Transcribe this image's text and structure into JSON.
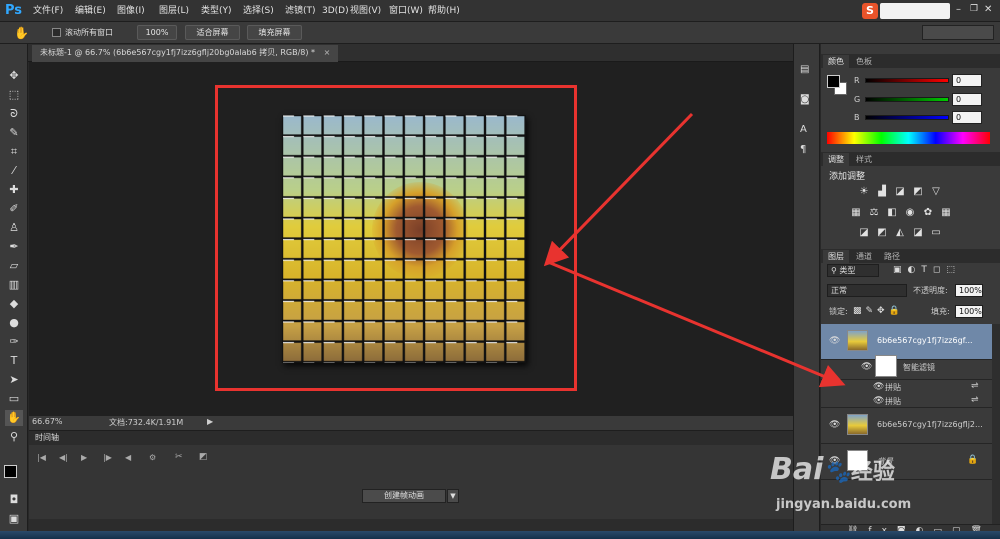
{
  "app": {
    "logo": "Ps"
  },
  "menu": [
    "文件(F)",
    "编辑(E)",
    "图像(I)",
    "图层(L)",
    "类型(Y)",
    "选择(S)",
    "滤镜(T)",
    "3D(D)",
    "视图(V)",
    "窗口(W)",
    "帮助(H)"
  ],
  "options": {
    "scroll_all_label": "滚动所有窗口",
    "zoom_100": "100%",
    "fit_screen": "适合屏幕",
    "fill_screen": "填充屏幕"
  },
  "document": {
    "tab_title": "未标题-1 @ 66.7% (6b6e567cgy1fj7izz6gflj20bg0alab6 拷贝, RGB/8) *"
  },
  "status": {
    "zoom": "66.67%",
    "doc_size": "文档:732.4K/1.91M"
  },
  "timeline": {
    "tab_label": "时间轴",
    "create_button": "创建帧动画"
  },
  "color_panel": {
    "tabs": [
      "颜色",
      "色板"
    ],
    "channels": [
      {
        "label": "R",
        "value": "0"
      },
      {
        "label": "G",
        "value": "0"
      },
      {
        "label": "B",
        "value": "0"
      }
    ]
  },
  "adjustments_panel": {
    "tabs": [
      "调整",
      "样式"
    ],
    "heading": "添加调整"
  },
  "layers_panel": {
    "tabs": [
      "图层",
      "通道",
      "路径"
    ],
    "filter_kind": "类型",
    "blend_mode": "正常",
    "opacity_label": "不透明度:",
    "opacity_value": "100%",
    "lock_label": "锁定:",
    "fill_label": "填充:",
    "fill_value": "100%",
    "layers": [
      {
        "name": "6b6e567cgy1fj7izz6gf...",
        "selected": true
      },
      {
        "name": "智能滤镜"
      },
      {
        "name": "拼贴"
      },
      {
        "name": "拼贴"
      },
      {
        "name": "6b6e567cgy1fj7izz6gflj2..."
      },
      {
        "name": "背景"
      }
    ]
  },
  "watermark": {
    "brand": "Bai",
    "brand2": "经验",
    "url": "jingyan.baidu.com"
  },
  "colors": {
    "annotation": "#e8332f",
    "ps_blue": "#31a8ff"
  }
}
